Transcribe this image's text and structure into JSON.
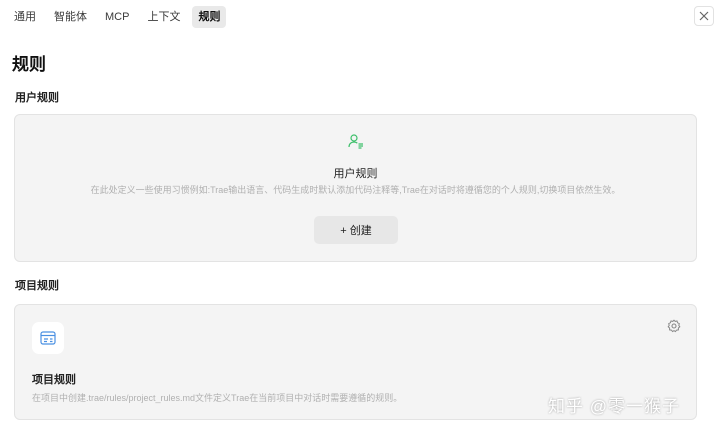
{
  "tabs": [
    "通用",
    "智能体",
    "MCP",
    "上下文",
    "规则"
  ],
  "active_tab": "规则",
  "page_title": "规则",
  "user_rules": {
    "section_title": "用户规则",
    "card_title": "用户规则",
    "description": "在此处定义一些使用习惯例如:Trae输出语言、代码生成时默认添加代码注释等,Trae在对话时将遵循您的个人规则,切换项目依然生效。",
    "create_label": "+ 创建",
    "icon": "user-rule-icon"
  },
  "project_rules": {
    "section_title": "项目规则",
    "card_title": "项目规则",
    "description": "在项目中创建.trae/rules/project_rules.md文件定义Trae在当前项目中对话时需要遵循的规则。",
    "icon": "project-rule-icon",
    "settings_icon": "gear-icon"
  },
  "watermark": "知乎 @零一猴子",
  "colors": {
    "accent_green": "#3cbf6a",
    "accent_blue": "#4a90e2"
  }
}
